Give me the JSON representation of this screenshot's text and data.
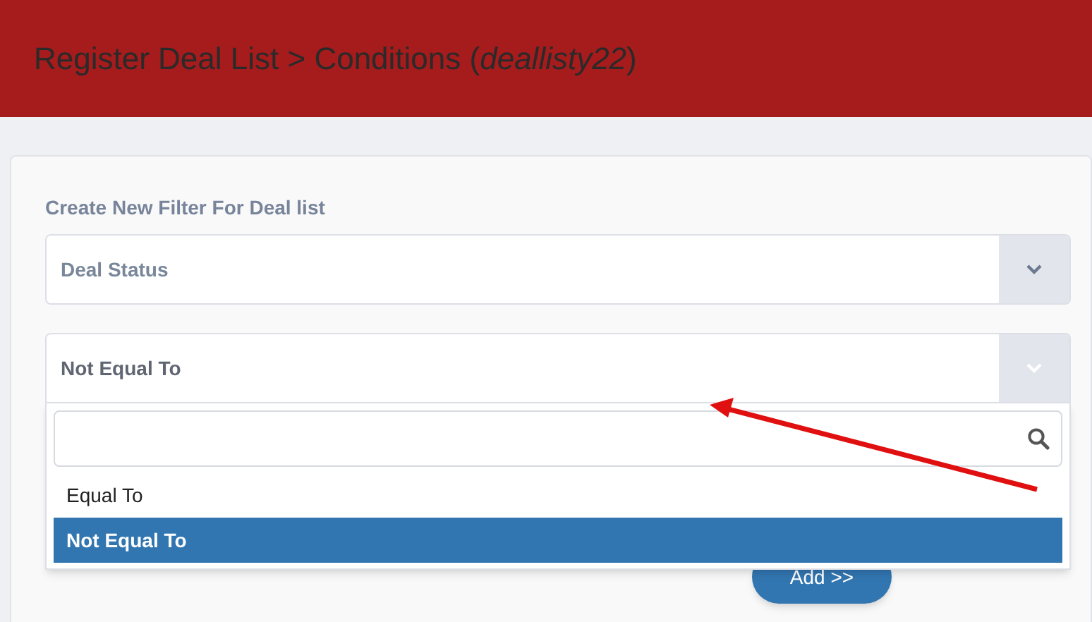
{
  "header": {
    "title": "Register Deal List > Conditions (*deallisty22*)"
  },
  "form": {
    "label": "Create New Filter For Deal list",
    "selects": [
      {
        "value": "Deal Status",
        "expanded": false
      },
      {
        "value": "Not Equal To",
        "expanded": true,
        "options": [
          {
            "label": "Equal To",
            "selected": false
          },
          {
            "label": "Not Equal To",
            "selected": true
          }
        ]
      }
    ],
    "add_button": "Add >>"
  }
}
